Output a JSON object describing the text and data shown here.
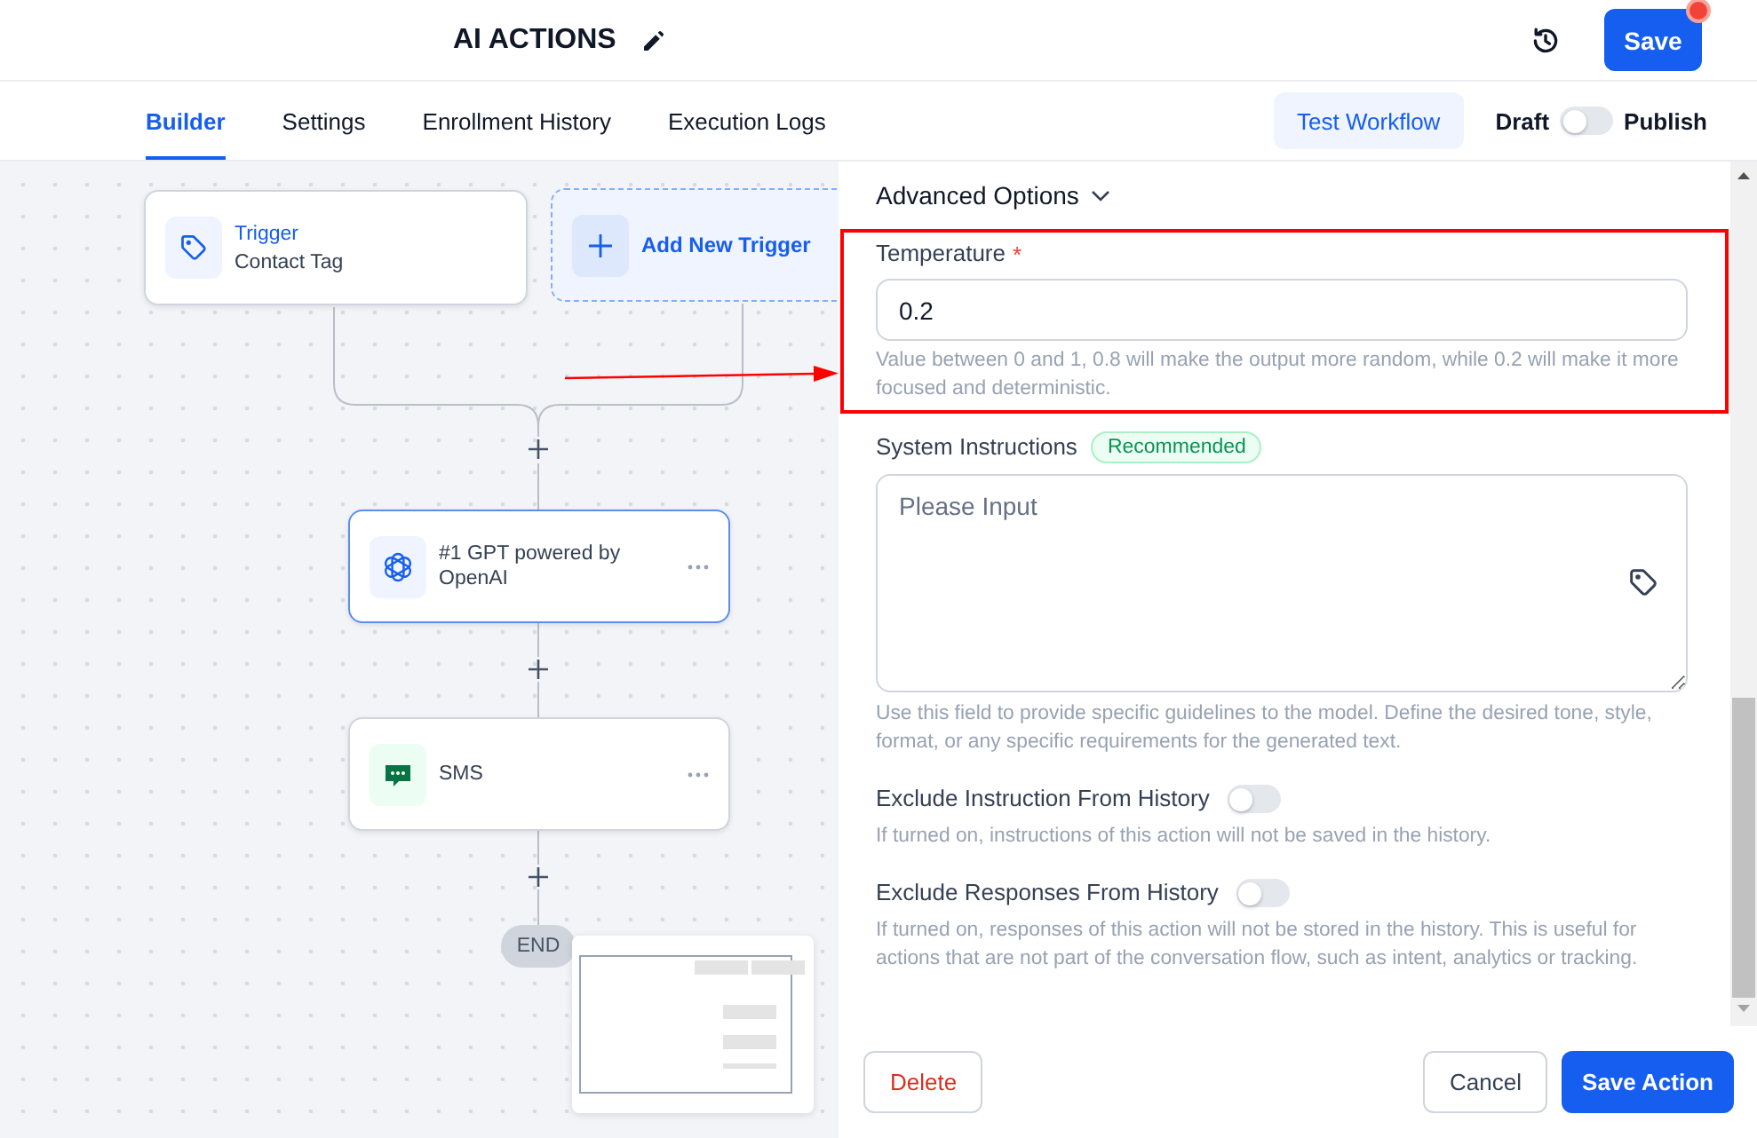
{
  "header": {
    "title": "AI ACTIONS",
    "save_button": "Save",
    "save_notification": true
  },
  "tabs": [
    {
      "label": "Builder",
      "selected": true
    },
    {
      "label": "Settings",
      "selected": false
    },
    {
      "label": "Enrollment History",
      "selected": false
    },
    {
      "label": "Execution Logs",
      "selected": false
    }
  ],
  "test_workflow_button": "Test Workflow",
  "publish_toggle": {
    "off_label": "Draft",
    "on_label": "Publish",
    "on": false
  },
  "canvas": {
    "triggers": [
      {
        "title": "Trigger",
        "subtitle": "Contact Tag"
      }
    ],
    "add_trigger": "Add New Trigger",
    "actions": [
      {
        "kind": "gpt",
        "title": "#1 GPT powered by OpenAI",
        "selected": true
      },
      {
        "kind": "sms",
        "title": "SMS",
        "selected": false
      }
    ],
    "end_label": "END"
  },
  "panel": {
    "advanced_options": {
      "label": "Advanced Options",
      "expanded": true
    },
    "temperature": {
      "label": "Temperature",
      "required_mark": "*",
      "value": "0.2",
      "help": "Value between 0 and 1, 0.8 will make the output more random, while 0.2 will make it more focused and deterministic."
    },
    "system_instructions": {
      "label": "System Instructions",
      "badge": "Recommended",
      "placeholder": "Please Input",
      "help": "Use this field to provide specific guidelines to the model. Define the desired tone, style, format, or any specific requirements for the generated text."
    },
    "switches": [
      {
        "label": "Exclude Instruction From History",
        "on": false,
        "help": "If turned on, instructions of this action will not be saved in the history."
      },
      {
        "label": "Exclude Responses From History",
        "on": false,
        "help": "If turned on, responses of this action will not be stored in the history. This is useful for actions that are not part of the conversation flow, such as intent, analytics or tracking."
      }
    ]
  },
  "footer": {
    "delete_button": "Delete",
    "cancel_button": "Cancel",
    "save_button": "Save Action"
  }
}
